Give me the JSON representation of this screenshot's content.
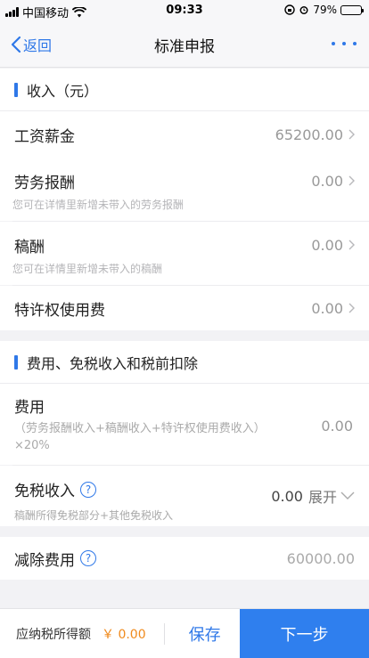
{
  "status_bar": {
    "carrier": "中国移动",
    "time": "09:33",
    "battery": "79%",
    "battery_level": 0.79
  },
  "nav": {
    "back_label": "返回",
    "title": "标准申报"
  },
  "sections": {
    "income_title": "收入（元）",
    "fees_title": "费用、免税收入和税前扣除"
  },
  "income": {
    "salary": {
      "label": "工资薪金",
      "value": "65200.00"
    },
    "labor": {
      "label": "劳务报酬",
      "value": "0.00",
      "hint": "您可在详情里新增未带入的劳务报酬"
    },
    "royalty": {
      "label": "稿酬",
      "value": "0.00",
      "hint": "您可在详情里新增未带入的稿酬"
    },
    "franchise": {
      "label": "特许权使用费",
      "value": "0.00"
    }
  },
  "fees": {
    "expense": {
      "label": "费用",
      "formula": "（劳务报酬收入+稿酬收入+特许权使用费收入）×20%",
      "value": "0.00"
    },
    "tax_free": {
      "label": "免税收入",
      "sub": "稿酬所得免税部分+其他免税收入",
      "value": "0.00",
      "expand_label": "展开"
    },
    "deduction": {
      "label": "减除费用",
      "value": "60000.00"
    }
  },
  "bottom": {
    "taxable_label": "应纳税所得额",
    "taxable_amount": "￥ 0.00",
    "save_label": "保存",
    "next_label": "下一步"
  },
  "colors": {
    "accent": "#2f78e8",
    "amount": "#f08a1c"
  }
}
